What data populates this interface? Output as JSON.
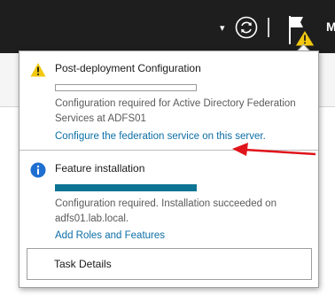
{
  "topbar": {
    "dropdown_glyph": "▾",
    "refresh_icon": "refresh-icon",
    "flag_icon": "notification-flag-icon",
    "warning_icon": "warning-icon",
    "user_initial": "M"
  },
  "notifications": [
    {
      "title": "Post-deployment Configuration",
      "icon": "warning-icon",
      "progress": 0,
      "message": "Configuration required for Active Directory Federation Services at ADFS01",
      "link": "Configure the federation service on this server."
    },
    {
      "title": "Feature installation",
      "icon": "info-icon",
      "progress": 1,
      "message": "Configuration required. Installation succeeded on adfs01.lab.local.",
      "link": "Add Roles and Features"
    }
  ],
  "task_details_label": "Task Details",
  "colors": {
    "topbar": "#1e1e1e",
    "accent": "#0e7493",
    "link": "#0c6ea6",
    "warning": "#f2c811",
    "info": "#1f6fd1",
    "annotation_arrow": "#e0141b"
  }
}
